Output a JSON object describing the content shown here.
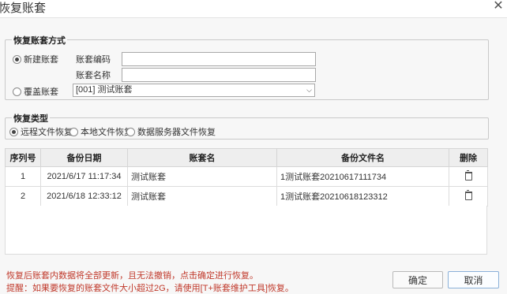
{
  "window": {
    "title": "恢复账套"
  },
  "restore_mode": {
    "legend": "恢复账套方式",
    "new_option": "新建账套",
    "code_label": "账套编码",
    "code_value": "",
    "name_label": "账套名称",
    "name_value": "",
    "overwrite_option": "覆盖账套",
    "account_select_value": "[001] 测试账套"
  },
  "restore_type": {
    "legend": "恢复类型",
    "options": [
      "远程文件恢复",
      "本地文件恢复",
      "数据服务器文件恢复"
    ],
    "selected_index": 0
  },
  "table": {
    "headers": [
      "序列号",
      "备份日期",
      "账套名",
      "备份文件名",
      "删除"
    ],
    "rows": [
      {
        "seq": "1",
        "date": "2021/6/17 11:17:34",
        "account": "测试账套",
        "file": "1测试账套20210617111734"
      },
      {
        "seq": "2",
        "date": "2021/6/18 12:33:12",
        "account": "测试账套",
        "file": "1测试账套20210618123312"
      }
    ]
  },
  "notes": {
    "line1": "恢复后账套内数据将全部更新，且无法撤销，点击确定进行恢复。",
    "line2": "提醒：如果要恢复的账套文件大小超过2G，请使用[T+账套维护工具]恢复。"
  },
  "buttons": {
    "ok": "确定",
    "cancel": "取消"
  },
  "colors": {
    "warning_text": "#c0392b",
    "primary_border": "#8ab0d9",
    "account_text": "#7a6a00"
  }
}
